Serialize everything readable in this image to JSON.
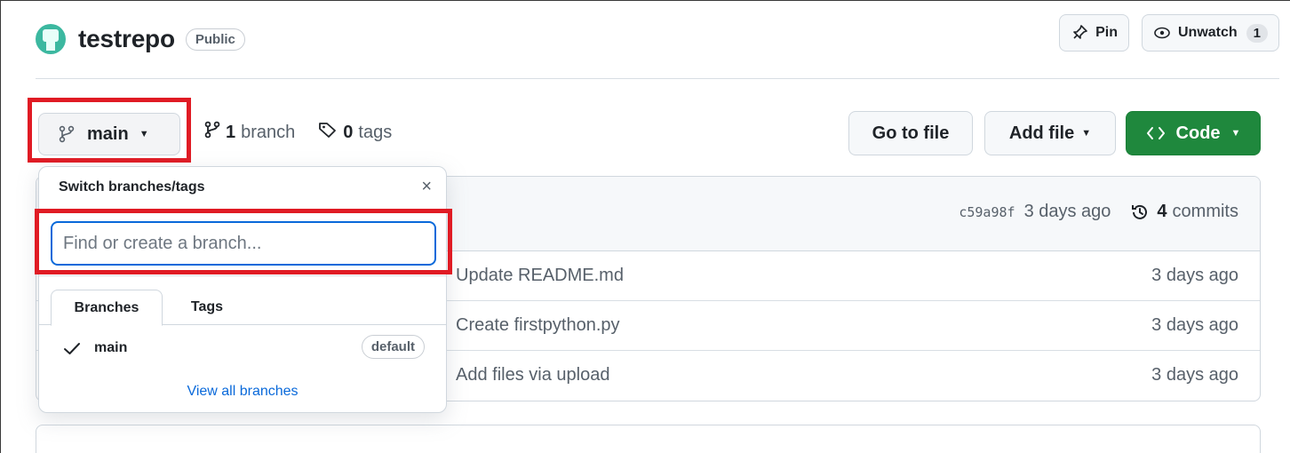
{
  "repo": {
    "name": "testrepo",
    "visibility": "Public",
    "pin_label": "Pin",
    "watch_label": "Unwatch",
    "watch_count": "1"
  },
  "branch_bar": {
    "current_branch": "main",
    "branch_count": "1",
    "branch_word": "branch",
    "tag_count": "0",
    "tag_word": "tags",
    "go_to_file": "Go to file",
    "add_file": "Add file",
    "code": "Code"
  },
  "files": {
    "commit_sha": "c59a98f",
    "commit_ago": "3 days ago",
    "commits_count": "4",
    "commits_word": "commits",
    "rows": [
      {
        "message": "Update README.md",
        "ago": "3 days ago"
      },
      {
        "message": "Create firstpython.py",
        "ago": "3 days ago"
      },
      {
        "message": "Add files via upload",
        "ago": "3 days ago"
      }
    ]
  },
  "popover": {
    "title": "Switch branches/tags",
    "close": "×",
    "placeholder": "Find or create a branch...",
    "tabs": [
      "Branches",
      "Tags"
    ],
    "branch_name": "main",
    "default_badge": "default",
    "view_all": "View all branches"
  },
  "colors": {
    "accent_blue": "#0969da",
    "code_green": "#1f883d",
    "highlight_red": "#e01b24"
  },
  "icons": {
    "pin": "pin-icon",
    "eye": "eye-icon",
    "branch": "git-branch-icon",
    "tag": "tag-icon",
    "code": "code-icon",
    "history": "history-icon",
    "check": "check-icon"
  }
}
